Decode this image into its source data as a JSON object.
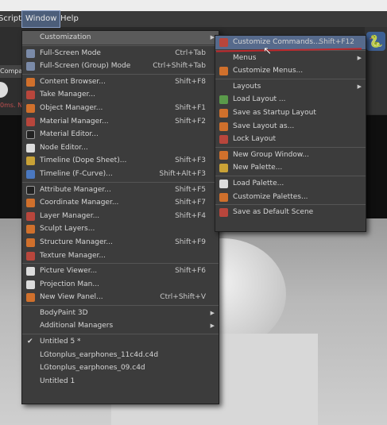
{
  "menubar": {
    "items": [
      {
        "label": "Script"
      },
      {
        "label": "Window"
      },
      {
        "label": "Help"
      }
    ]
  },
  "background": {
    "panel_tab": "Compa",
    "panel_red_text": "0ms. N"
  },
  "window_menu": {
    "items": [
      {
        "label": "Customization",
        "shortcut": "",
        "submenu": true,
        "icon": "",
        "highlight": true
      },
      {
        "sep": true
      },
      {
        "label": "Full-Screen Mode",
        "shortcut": "Ctrl+Tab",
        "icon": "fullscreen-icon",
        "color": "#7a8aa8"
      },
      {
        "label": "Full-Screen (Group) Mode",
        "shortcut": "Ctrl+Shift+Tab",
        "icon": "fullscreen-group-icon",
        "color": "#7a8aa8"
      },
      {
        "sep": true
      },
      {
        "label": "Content Browser...",
        "shortcut": "Shift+F8",
        "icon": "content-browser-icon",
        "color": "#d0702c"
      },
      {
        "label": "Take Manager...",
        "shortcut": "",
        "icon": "take-manager-icon",
        "color": "#b8463c"
      },
      {
        "label": "Object Manager...",
        "shortcut": "Shift+F1",
        "icon": "object-manager-icon",
        "color": "#d0702c"
      },
      {
        "label": "Material Manager...",
        "shortcut": "Shift+F2",
        "icon": "material-manager-icon",
        "color": "#b8463c"
      },
      {
        "label": "Material Editor...",
        "shortcut": "",
        "icon": "material-editor-icon",
        "color": "#222"
      },
      {
        "label": "Node Editor...",
        "shortcut": "",
        "icon": "node-editor-icon",
        "color": "#dcdcdc"
      },
      {
        "label": "Timeline (Dope Sheet)...",
        "shortcut": "Shift+F3",
        "icon": "timeline-dope-sheet-icon",
        "color": "#c9a236"
      },
      {
        "label": "Timeline (F-Curve)...",
        "shortcut": "Shift+Alt+F3",
        "icon": "timeline-fcurve-icon",
        "color": "#4a78c0"
      },
      {
        "sep": true
      },
      {
        "label": "Attribute Manager...",
        "shortcut": "Shift+F5",
        "icon": "attribute-manager-icon",
        "color": "#222"
      },
      {
        "label": "Coordinate Manager...",
        "shortcut": "Shift+F7",
        "icon": "coordinate-manager-icon",
        "color": "#d0702c"
      },
      {
        "label": "Layer Manager...",
        "shortcut": "Shift+F4",
        "icon": "layer-manager-icon",
        "color": "#b8463c"
      },
      {
        "label": "Sculpt Layers...",
        "shortcut": "",
        "icon": "sculpt-layers-icon",
        "color": "#d0702c"
      },
      {
        "label": "Structure Manager...",
        "shortcut": "Shift+F9",
        "icon": "structure-manager-icon",
        "color": "#d0702c"
      },
      {
        "label": "Texture Manager...",
        "shortcut": "",
        "icon": "texture-manager-icon",
        "color": "#b8463c"
      },
      {
        "sep": true
      },
      {
        "label": "Picture Viewer...",
        "shortcut": "Shift+F6",
        "icon": "picture-viewer-icon",
        "color": "#dcdcdc"
      },
      {
        "label": "Projection Man...",
        "shortcut": "",
        "icon": "projection-man-icon",
        "color": "#dcdcdc"
      },
      {
        "label": "New View Panel...",
        "shortcut": "Ctrl+Shift+V",
        "icon": "new-view-panel-icon",
        "color": "#d0702c"
      },
      {
        "sep": true
      },
      {
        "label": "BodyPaint 3D",
        "shortcut": "",
        "submenu": true,
        "icon": ""
      },
      {
        "label": "Additional Managers",
        "shortcut": "",
        "submenu": true,
        "icon": ""
      },
      {
        "sep": true
      },
      {
        "label": "Untitled 5 *",
        "shortcut": "",
        "icon": "",
        "checked": true
      },
      {
        "label": "LGtonplus_earphones_11c4d.c4d",
        "shortcut": "",
        "icon": ""
      },
      {
        "label": "LGtonplus_earphones_09.c4d",
        "shortcut": "",
        "icon": ""
      },
      {
        "label": "Untitled 1",
        "shortcut": "",
        "icon": ""
      }
    ]
  },
  "customization_menu": {
    "items": [
      {
        "label": "Customize Commands...",
        "shortcut": "Shift+F12",
        "icon": "customize-commands-icon",
        "color": "#b8463c",
        "highlight": true
      },
      {
        "sep": true
      },
      {
        "label": "Menus",
        "shortcut": "",
        "submenu": true,
        "icon": ""
      },
      {
        "label": "Customize Menus...",
        "shortcut": "",
        "icon": "customize-menus-icon",
        "color": "#d0702c"
      },
      {
        "sep": true
      },
      {
        "label": "Layouts",
        "shortcut": "",
        "submenu": true,
        "icon": ""
      },
      {
        "label": "Load Layout ...",
        "shortcut": "",
        "icon": "load-layout-icon",
        "color": "#5a9a4a"
      },
      {
        "label": "Save as Startup Layout",
        "shortcut": "",
        "icon": "save-startup-layout-icon",
        "color": "#d0702c"
      },
      {
        "label": "Save Layout as...",
        "shortcut": "",
        "icon": "save-layout-as-icon",
        "color": "#d0702c"
      },
      {
        "label": "Lock Layout",
        "shortcut": "",
        "icon": "lock-layout-icon",
        "color": "#b8463c"
      },
      {
        "sep": true
      },
      {
        "label": "New Group Window...",
        "shortcut": "",
        "icon": "new-group-window-icon",
        "color": "#d0702c"
      },
      {
        "label": "New Palette...",
        "shortcut": "",
        "icon": "new-palette-icon",
        "color": "#c9a236"
      },
      {
        "sep": true
      },
      {
        "label": "Load Palette...",
        "shortcut": "",
        "icon": "load-palette-icon",
        "color": "#dcdcdc"
      },
      {
        "label": "Customize Palettes...",
        "shortcut": "",
        "icon": "customize-palettes-icon",
        "color": "#d0702c"
      },
      {
        "sep": true
      },
      {
        "label": "Save as Default Scene",
        "shortcut": "",
        "icon": "save-default-scene-icon",
        "color": "#b8463c"
      }
    ]
  }
}
